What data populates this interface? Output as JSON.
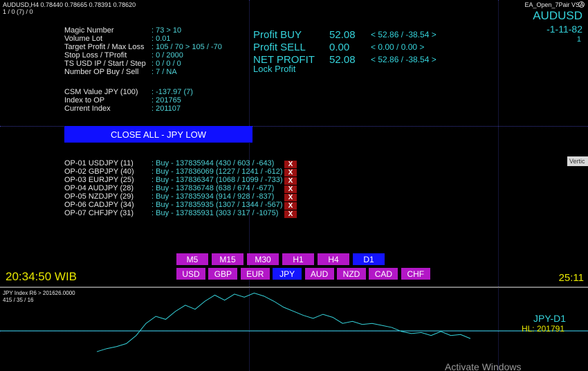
{
  "header": {
    "symbol_line": "AUDUSD,H4  0.78440 0.78665 0.78391 0.78620",
    "sub_line": "1 / 0 (7) / 0",
    "ea_name": "EA_Open_7Pair VSA"
  },
  "top_right": {
    "pair": "AUDUSD",
    "date": "-1-11-82",
    "num": "1"
  },
  "info": [
    {
      "label": "Magic Number",
      "value": ": 73 > 10"
    },
    {
      "label": "Volume Lot",
      "value": ": 0.01"
    },
    {
      "label": "Target Profit / Max Loss",
      "value": ": 105 / 70 > 105 / -70"
    },
    {
      "label": "Stop Loss / TProfit",
      "value": ": 0 / 2000"
    },
    {
      "label": "TS USD IP / Start / Step",
      "value": ": 0 / 0 / 0"
    },
    {
      "label": "Number OP Buy / Sell",
      "value": ": 7 / NA"
    }
  ],
  "info2": [
    {
      "label": "CSM Value JPY (100)",
      "value": ": -137.97 (7)"
    },
    {
      "label": "Index to OP",
      "value": ": 201765"
    },
    {
      "label": "Current Index",
      "value": ": 201107"
    }
  ],
  "profit": [
    {
      "label": "Profit BUY",
      "value": "52.08",
      "range": "< 52.86 / -38.54 >"
    },
    {
      "label": "Profit SELL",
      "value": "0.00",
      "range": "< 0.00 / 0.00 >"
    },
    {
      "label": "NET PROFIT",
      "value": "52.08",
      "range": "< 52.86 / -38.54 >"
    }
  ],
  "lock_profit": "Lock Profit",
  "close_all_label": "CLOSE ALL - JPY LOW",
  "vertical_tag": "Vertic",
  "orders": [
    {
      "name": "OP-01 USDJPY (11)",
      "data": ": Buy - 137835944 (430 / 603 / -643)"
    },
    {
      "name": "OP-02 GBPJPY (40)",
      "data": ": Buy - 137836069 (1227 / 1241 / -612)"
    },
    {
      "name": "OP-03 EURJPY (25)",
      "data": ": Buy - 137836347 (1068 / 1099 / -733)"
    },
    {
      "name": "OP-04 AUDJPY (28)",
      "data": ": Buy - 137836748 (638 / 674 / -677)"
    },
    {
      "name": "OP-05 NZDJPY (29)",
      "data": ": Buy - 137835934 (914 / 928 / -837)"
    },
    {
      "name": "OP-06 CADJPY (34)",
      "data": ": Buy - 137835935 (1307 / 1344 / -567)"
    },
    {
      "name": "OP-07 CHFJPY (31)",
      "data": ": Buy - 137835931 (303 / 317 / -1075)"
    }
  ],
  "order_close_label": "X",
  "timeframes": [
    {
      "label": "M5",
      "active": false
    },
    {
      "label": "M15",
      "active": false
    },
    {
      "label": "M30",
      "active": false
    },
    {
      "label": "H1",
      "active": false
    },
    {
      "label": "H4",
      "active": false
    },
    {
      "label": "D1",
      "active": true
    }
  ],
  "currencies": [
    {
      "label": "USD",
      "active": false
    },
    {
      "label": "GBP",
      "active": false
    },
    {
      "label": "EUR",
      "active": false
    },
    {
      "label": "JPY",
      "active": true
    },
    {
      "label": "AUD",
      "active": false
    },
    {
      "label": "NZD",
      "active": false
    },
    {
      "label": "CAD",
      "active": false
    },
    {
      "label": "CHF",
      "active": false
    }
  ],
  "clock_left": "20:34:50 WIB",
  "clock_right": "25:11",
  "subwindow": {
    "title": "JPY Index R6 >  201626.0000",
    "sub": "415 / 35 / 16",
    "label": "JPY-D1",
    "hl": "HL: 201791"
  },
  "watermark": "Activate Windows",
  "colors": {
    "violet": "#b317c7",
    "blue": "#1414ff",
    "cyan": "#35d2da",
    "yellow": "#e8e800",
    "close_red": "#9a1010"
  },
  "chart_data": {
    "type": "line",
    "series": [
      {
        "values": [
          201560,
          201575,
          201585,
          201600,
          201640,
          201700,
          201735,
          201720,
          201760,
          201790,
          201770,
          201810,
          201840,
          201815,
          201845,
          201830,
          201850,
          201835,
          201810,
          201780,
          201760,
          201740,
          201725,
          201745,
          201730,
          201700,
          201710,
          201695,
          201700,
          201690,
          201680,
          201660,
          201650,
          201655,
          201640,
          201660,
          201640,
          201645,
          201625
        ]
      }
    ]
  }
}
